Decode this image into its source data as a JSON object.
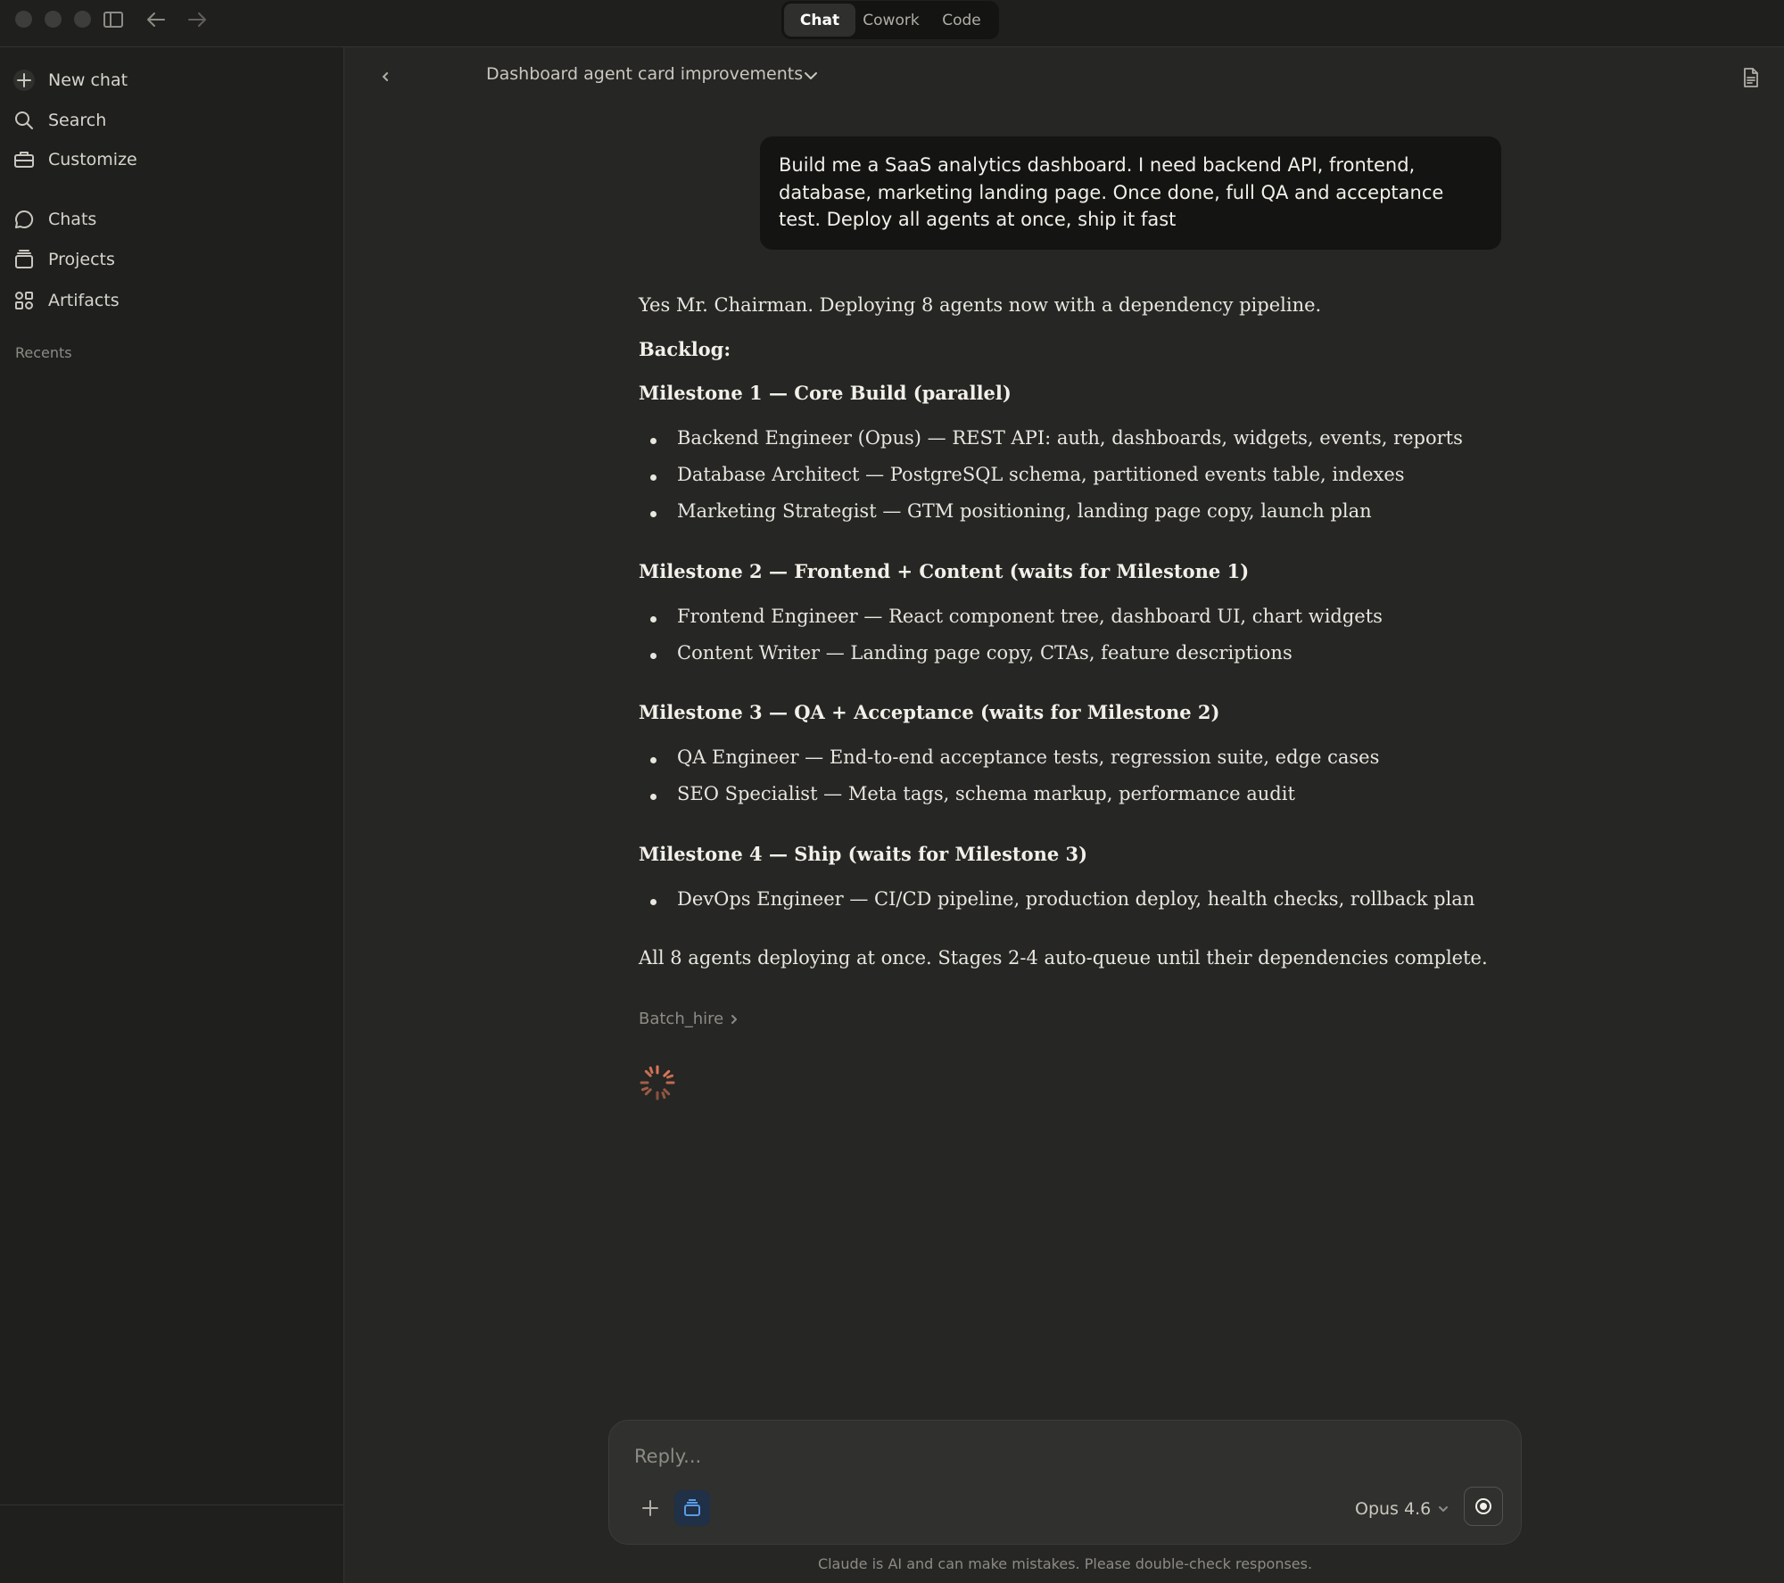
{
  "titlebar": {
    "modes": [
      {
        "label": "Chat",
        "active": true
      },
      {
        "label": "Cowork",
        "active": false
      },
      {
        "label": "Code",
        "active": false
      }
    ]
  },
  "sidebar": {
    "items": [
      {
        "label": "New chat",
        "icon": "plus-icon"
      },
      {
        "label": "Search",
        "icon": "search-icon"
      },
      {
        "label": "Customize",
        "icon": "briefcase-icon"
      },
      {
        "label": "Chats",
        "icon": "chat-bubble-icon"
      },
      {
        "label": "Projects",
        "icon": "folder-icon"
      },
      {
        "label": "Artifacts",
        "icon": "artifacts-icon"
      }
    ],
    "recents_label": "Recents"
  },
  "chat": {
    "title": "Dashboard agent card improvements",
    "user_message": "Build me a SaaS analytics dashboard. I need backend API, frontend, database, marketing landing page. Once done, full QA and acceptance test. Deploy all agents at once, ship it fast",
    "assistant": {
      "intro": "Yes Mr. Chairman. Deploying 8 agents now with a dependency pipeline.",
      "backlog_label": "Backlog:",
      "milestones": [
        {
          "title": "Milestone 1 — Core Build (parallel)",
          "items": [
            "Backend Engineer (Opus) — REST API: auth, dashboards, widgets, events, reports",
            "Database Architect — PostgreSQL schema, partitioned events table, indexes",
            "Marketing Strategist — GTM positioning, landing page copy, launch plan"
          ]
        },
        {
          "title": "Milestone 2 — Frontend + Content (waits for Milestone 1)",
          "items": [
            "Frontend Engineer — React component tree, dashboard UI, chart widgets",
            "Content Writer — Landing page copy, CTAs, feature descriptions"
          ]
        },
        {
          "title": "Milestone 3 — QA + Acceptance (waits for Milestone 2)",
          "items": [
            "QA Engineer — End-to-end acceptance tests, regression suite, edge cases",
            "SEO Specialist — Meta tags, schema markup, performance audit"
          ]
        },
        {
          "title": "Milestone 4 — Ship (waits for Milestone 3)",
          "items": [
            "DevOps Engineer — CI/CD pipeline, production deploy, health checks, rollback plan"
          ]
        }
      ],
      "outro": "All 8 agents deploying at once. Stages 2-4 auto-queue until their dependencies complete.",
      "tool_call": "Batch_hire"
    }
  },
  "composer": {
    "placeholder": "Reply...",
    "model": "Opus 4.6"
  },
  "disclaimer": "Claude is AI and can make mistakes. Please double-check responses.",
  "colors": {
    "background": "#262624",
    "sidebar": "#1f1f1e",
    "user_bubble": "#141413",
    "spinner": "#d97757",
    "project_accent": "#5b9be6"
  }
}
